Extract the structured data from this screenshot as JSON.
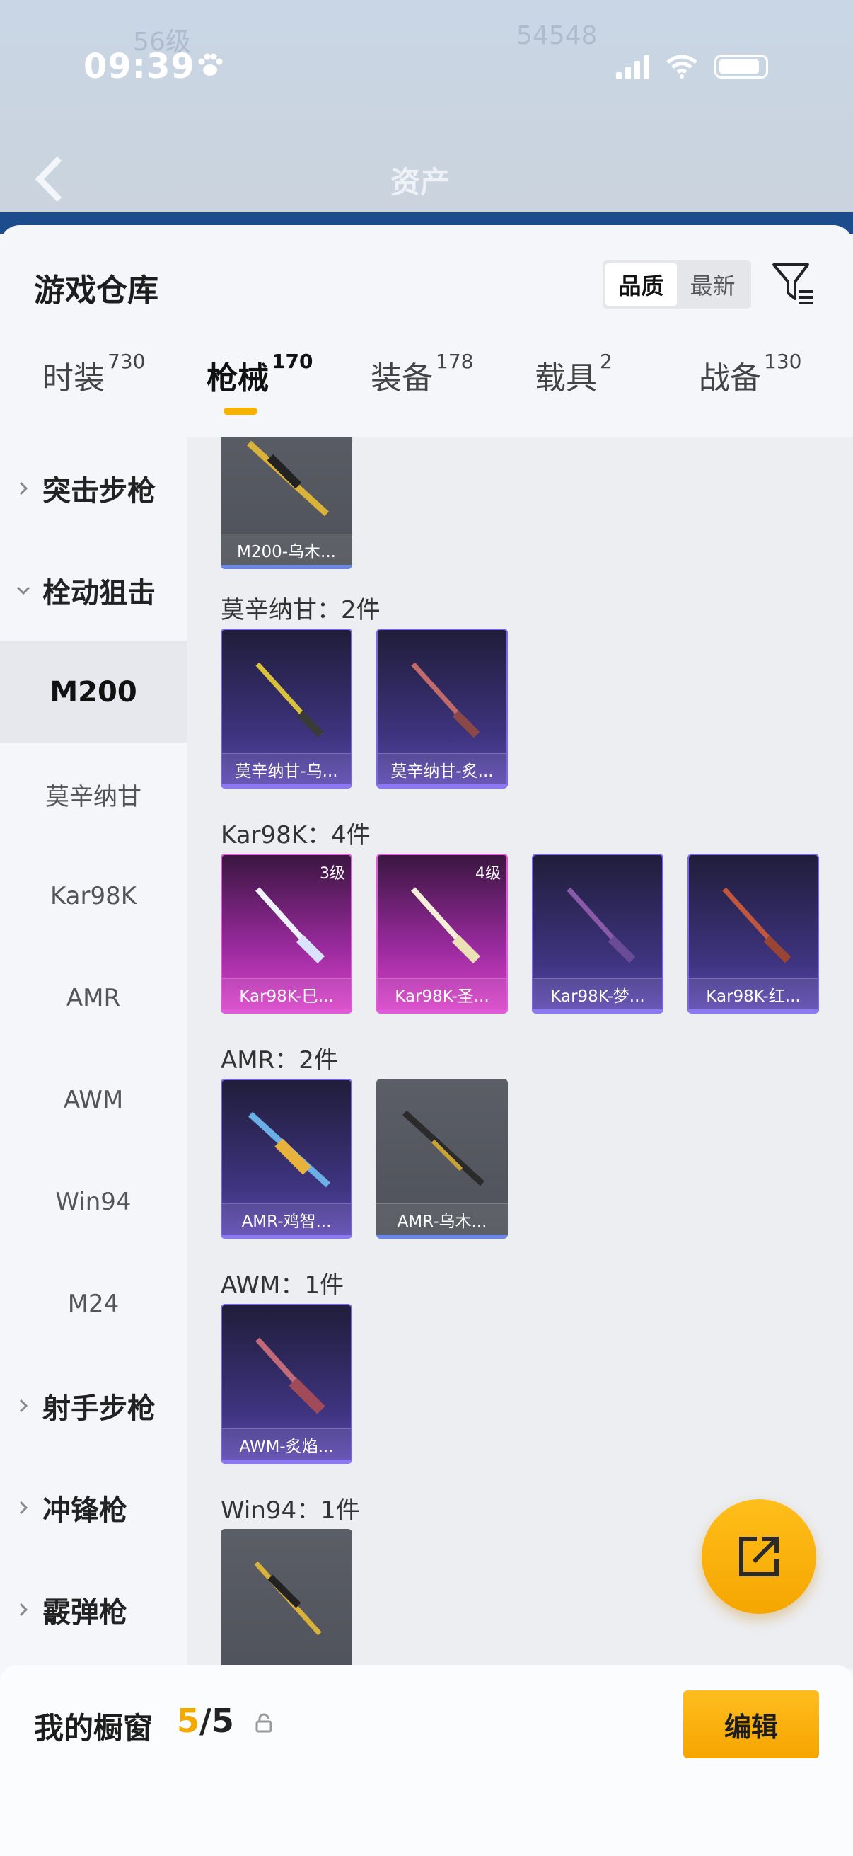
{
  "status_bar": {
    "time": "09:39"
  },
  "header": {
    "title": "资产"
  },
  "warehouse": {
    "title": "游戏仓库",
    "sort": {
      "quality": "品质",
      "newest": "最新"
    },
    "tabs": [
      {
        "label": "时装",
        "count": "730"
      },
      {
        "label": "枪械",
        "count": "170"
      },
      {
        "label": "装备",
        "count": "178"
      },
      {
        "label": "载具",
        "count": "2"
      },
      {
        "label": "战备",
        "count": "130"
      }
    ]
  },
  "sidebar": {
    "items": [
      {
        "label": "突击步枪"
      },
      {
        "label": "栓动狙击"
      },
      {
        "label": "M200"
      },
      {
        "label": "莫辛纳甘"
      },
      {
        "label": "Kar98K"
      },
      {
        "label": "AMR"
      },
      {
        "label": "AWM"
      },
      {
        "label": "Win94"
      },
      {
        "label": "M24"
      },
      {
        "label": "射手步枪"
      },
      {
        "label": "冲锋枪"
      },
      {
        "label": "霰弹枪"
      }
    ]
  },
  "groups": {
    "m200": {
      "items": [
        {
          "name": "M200-乌木..."
        }
      ]
    },
    "mosin": {
      "label": "莫辛纳甘：2件",
      "items": [
        {
          "name": "莫辛纳甘-乌..."
        },
        {
          "name": "莫辛纳甘-炙..."
        }
      ]
    },
    "kar98k": {
      "label": "Kar98K：4件",
      "items": [
        {
          "name": "Kar98K-巳...",
          "level": "3级"
        },
        {
          "name": "Kar98K-圣...",
          "level": "4级"
        },
        {
          "name": "Kar98K-梦..."
        },
        {
          "name": "Kar98K-红..."
        }
      ]
    },
    "amr": {
      "label": "AMR：2件",
      "items": [
        {
          "name": "AMR-鸡智..."
        },
        {
          "name": "AMR-乌木..."
        }
      ]
    },
    "awm": {
      "label": "AWM：1件",
      "items": [
        {
          "name": "AWM-炙焰..."
        }
      ]
    },
    "win94": {
      "label": "Win94：1件"
    }
  },
  "showcase": {
    "label": "我的橱窗",
    "current": "5",
    "total": "/5",
    "edit": "编辑"
  },
  "colors": {
    "accent": "#f5b300",
    "purple_rarity": "#7b66e6",
    "pink_rarity": "#e05ad8",
    "gray_rarity": "#6b86e4"
  },
  "icons": [
    "paw-icon",
    "signal-icon",
    "wifi-icon",
    "battery-icon",
    "back-arrow-icon",
    "filter-icon",
    "chevron-right-icon",
    "chevron-down-icon",
    "share-icon",
    "lock-icon"
  ]
}
